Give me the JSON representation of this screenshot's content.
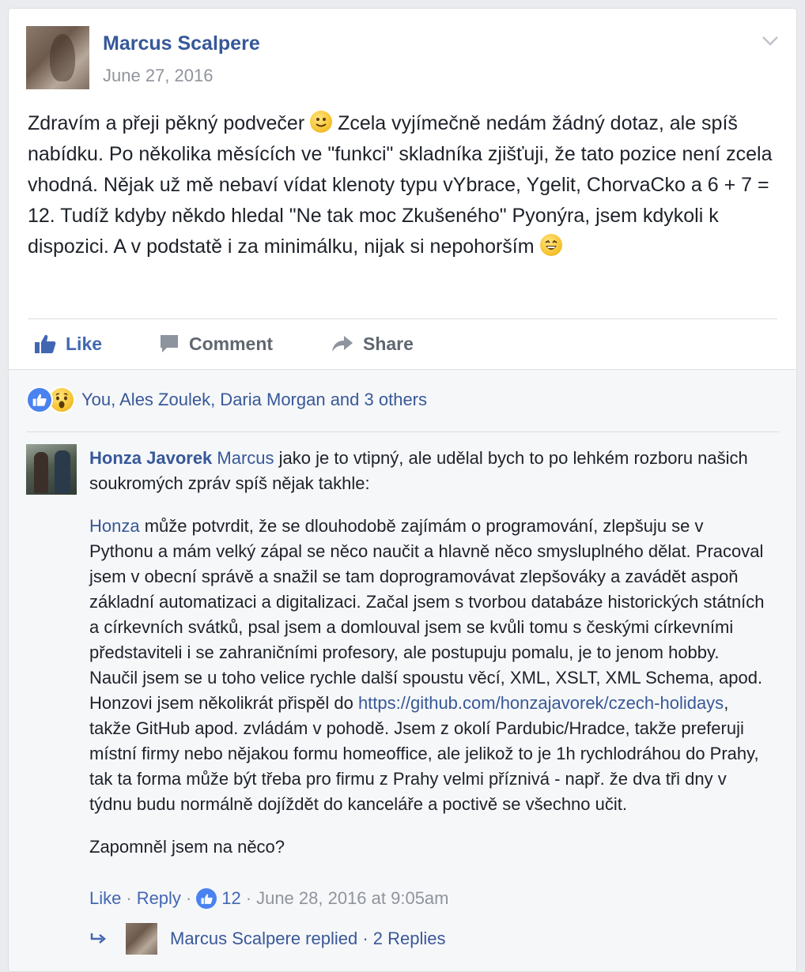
{
  "post": {
    "author": "Marcus Scalpere",
    "date": "June 27, 2016",
    "text_1": "Zdravím a přeji pěkný podvečer",
    "text_2": "Zcela vyjímečně nedám žádný dotaz, ale spíš nabídku. Po několika měsících ve \"funkci\" skladníka zjišťuji, že tato pozice není zcela vhodná. Nějak už mě nebaví vídat klenoty typu vYbrace, Ygelit, ChorvaCko a 6 + 7 = 12. Tudíž kdyby někdo hledal \"Ne tak moc Zkušeného\" Pyonýra, jsem kdykoli k dispozici. A v podstatě i za minimálku, nijak si nepohorším"
  },
  "actions": {
    "like": "Like",
    "comment": "Comment",
    "share": "Share"
  },
  "reactions": {
    "summary": "You, Ales Zoulek, Daria Morgan and 3 others"
  },
  "comment": {
    "author": "Honza Javorek",
    "mention": "Marcus",
    "intro": " jako je to vtipný, ale udělal bych to po lehkém rozboru našich soukromých zpráv spíš nějak takhle:",
    "para_mention": "Honza",
    "para_1": " může potvrdit, že se dlouhodobě zajímám o programování, zlepšuju se v Pythonu a mám velký zápal se něco naučit a hlavně něco smysluplného dělat. Pracoval jsem v obecní správě a snažil se tam doprogramovávat zlepšováky a zavádět aspoň základní automatizaci a digitalizaci. Začal jsem s tvorbou databáze historických státních a církevních svátků, psal jsem a domlouval jsem se kvůli tomu s českými církevními představiteli i se zahraničními profesory, ale postupuju pomalu, je to jenom hobby. Naučil jsem se u toho velice rychle další spoustu věcí, XML, XSLT, XML Schema, apod. Honzovi jsem několikrát přispěl do ",
    "link": "https://github.com/honzajavorek/czech-holidays",
    "para_2": ", takže GitHub apod. zvládám v pohodě. Jsem z okolí Pardubic/Hradce, takže preferuji místní firmy nebo nějakou formu homeoffice, ale jelikož to je 1h rychlodráhou do Prahy, tak ta forma může být třeba pro firmu z Prahy velmi příznivá - např. že dva tři dny v týdnu budu normálně dojíždět do kanceláře a poctivě se všechno učit.",
    "closing": "Zapomněl jsem na něco?",
    "like_label": "Like",
    "reply_label": "Reply",
    "separator": "·",
    "like_count": "12",
    "timestamp": "June 28, 2016 at 9:05am",
    "replies_text": "Marcus Scalpere replied · 2 Replies"
  },
  "colors": {
    "link_blue": "#365899",
    "action_blue": "#4267b2",
    "meta_gray": "#90949c",
    "background": "#e9ebee"
  },
  "icons": [
    "chevron-down-icon",
    "smile-emoji-icon",
    "laugh-emoji-icon",
    "thumbs-up-icon",
    "comment-icon",
    "share-icon",
    "like-reaction-icon",
    "wow-reaction-icon",
    "reply-arrow-icon"
  ]
}
